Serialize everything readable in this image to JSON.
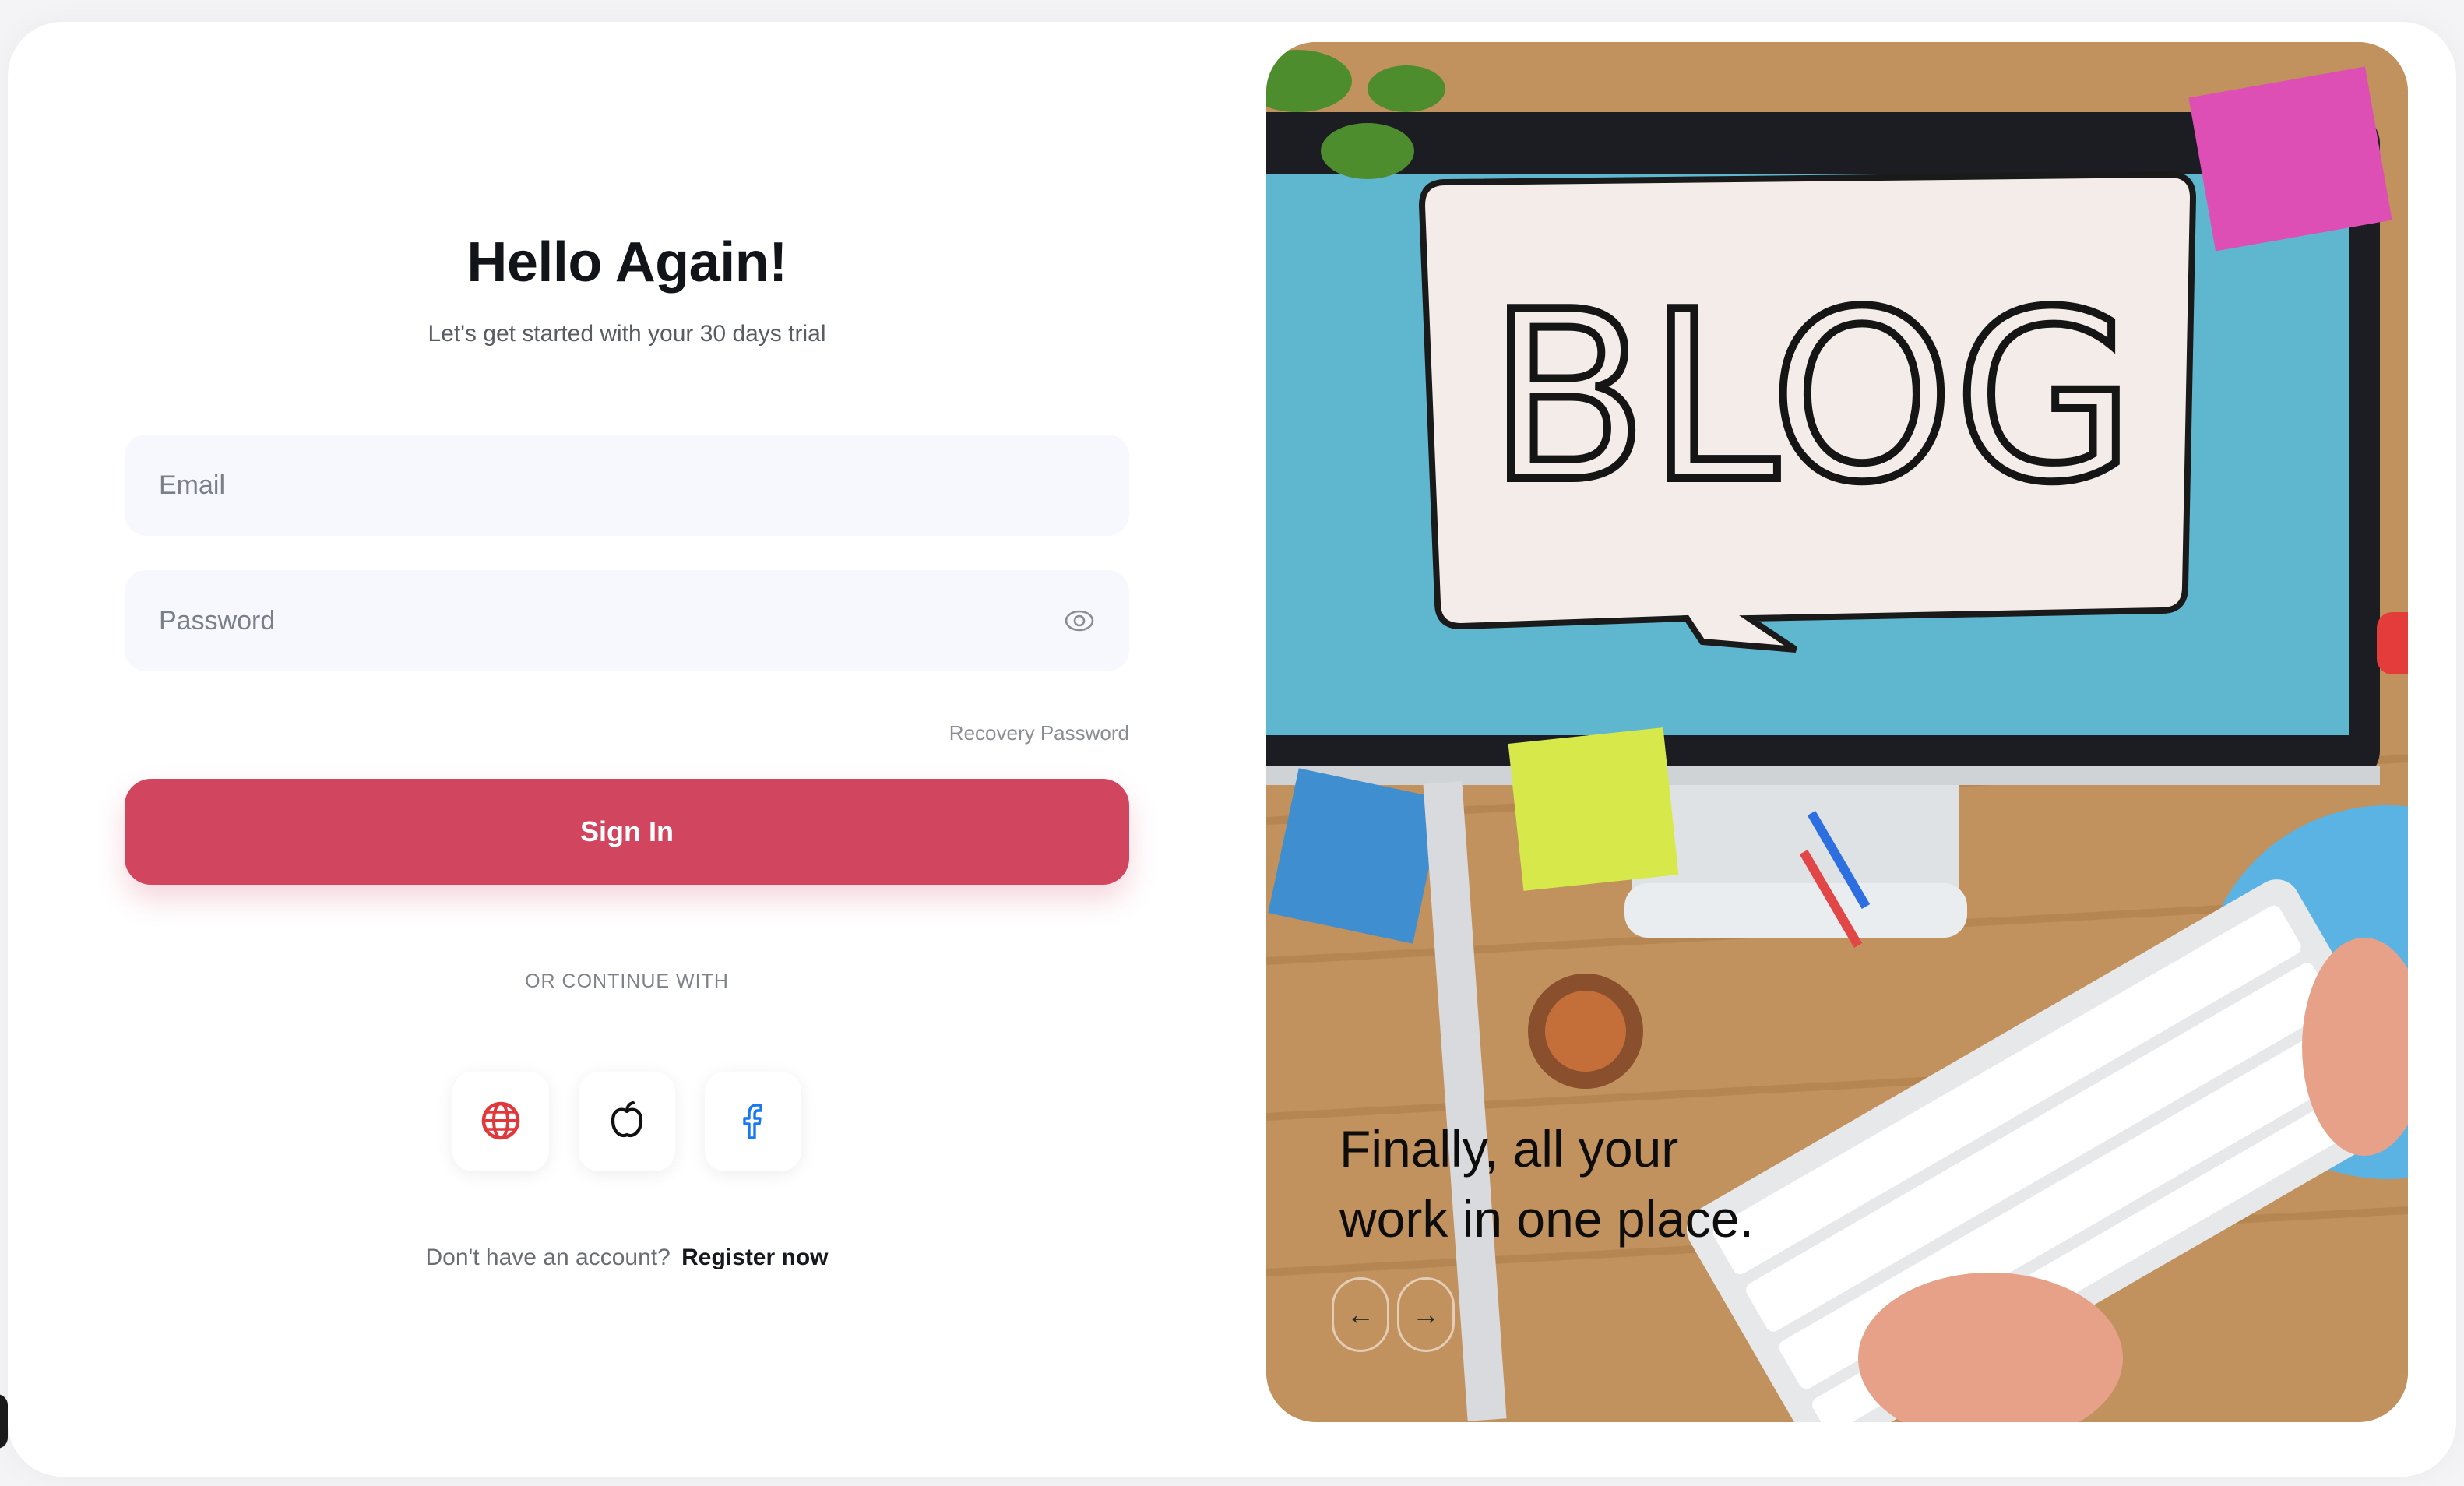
{
  "form": {
    "title": "Hello Again!",
    "subtitle": "Let's get started with your 30 days trial",
    "email_placeholder": "Email",
    "password_placeholder": "Password",
    "recovery_label": "Recovery Password",
    "signin_label": "Sign In",
    "divider_label": "OR CONTINUE WITH",
    "socials": [
      {
        "icon": "globe-icon",
        "color": "#e0383b"
      },
      {
        "icon": "apple-icon",
        "color": "#111111"
      },
      {
        "icon": "facebook-icon",
        "color": "#1877f2"
      }
    ],
    "register_prompt": "Don't have an account?",
    "register_link": "Register now"
  },
  "hero": {
    "tagline_line1": "Finally, all your",
    "tagline_line2": "work in one place.",
    "screen_text": "BLOG",
    "prev_icon": "arrow-left-icon",
    "next_icon": "arrow-right-icon"
  },
  "colors": {
    "accent": "#d1455f",
    "field_bg": "#f7f8fd",
    "title": "#111418"
  }
}
